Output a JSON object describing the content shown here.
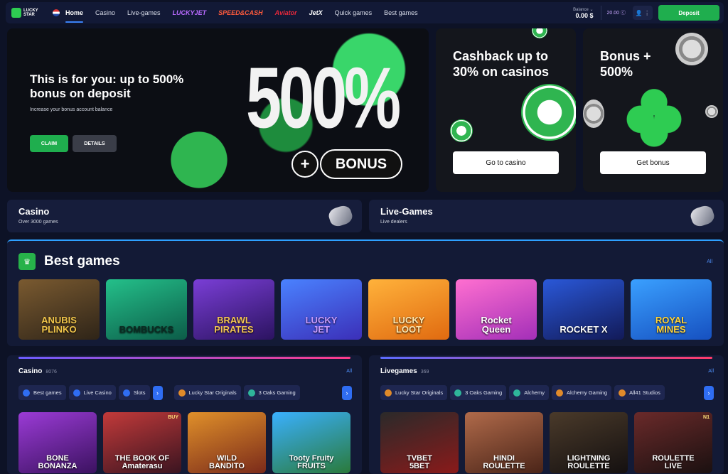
{
  "header": {
    "logo_text": "LUCKY STAR",
    "nav": [
      {
        "label": "Home",
        "active": true
      },
      {
        "label": "Casino"
      },
      {
        "label": "Live-games"
      },
      {
        "label": "LUCKYJET",
        "brand": true,
        "color": "#b96bff"
      },
      {
        "label": "SPEED&CASH",
        "brand": true,
        "color": "#ff5a3c"
      },
      {
        "label": "Aviator",
        "brand": true,
        "color": "#e8283b"
      },
      {
        "label": "JetX",
        "brand": true,
        "color": "#ffffff"
      },
      {
        "label": "Quick games"
      },
      {
        "label": "Best games"
      }
    ],
    "balance_label": "Balance ⌄",
    "balance_value": "0.00 $",
    "coins": "20.00 ⓒ",
    "user_icon": "👤 ⋮",
    "deposit_label": "Deposit"
  },
  "hero": {
    "title": "This is for you: up to 500% bonus on deposit",
    "subtitle": "Increase your bonus account balance",
    "claim_label": "CLAIM",
    "details_label": "DETAILS",
    "big_text": "500%",
    "plus": "+",
    "bonus_word": "BONUS"
  },
  "promos": {
    "cashback_title": "Cashback up to 30% on casinos",
    "cashback_button": "Go to casino",
    "bonus_title": "Bonus + 500%",
    "bonus_button": "Get bonus"
  },
  "categories": {
    "casino_title": "Casino",
    "casino_sub": "Over 3000 games",
    "live_title": "Live-Games",
    "live_sub": "Live dealers"
  },
  "best_games": {
    "icon": "♛",
    "title": "Best games",
    "all_label": "All",
    "tiles": [
      {
        "name": "ANUBIS\nPLINKO",
        "bg": "linear-gradient(160deg,#7a5a30,#2e2418)",
        "color": "#f1c54a"
      },
      {
        "name": "BOMBUCKS",
        "bg": "linear-gradient(160deg,#24c08a,#0c5c48)",
        "color": "#0b2b22"
      },
      {
        "name": "BRAWL\nPIRATES",
        "bg": "linear-gradient(160deg,#7a3ed6,#2b1360)",
        "color": "#f3c453"
      },
      {
        "name": "LUCKY\nJET",
        "bg": "linear-gradient(160deg,#4a82ff,#3b2fb8)",
        "color": "#c89bff"
      },
      {
        "name": "LUCKY\nLOOT",
        "bg": "linear-gradient(160deg,#ffb23b,#e06a10)",
        "color": "#ffe8b0"
      },
      {
        "name": "Rocket\nQueen",
        "bg": "linear-gradient(160deg,#ff6fd0,#a32fb8)",
        "color": "#ffffff"
      },
      {
        "name": "ROCKET X",
        "bg": "linear-gradient(160deg,#2a58d8,#121a58)",
        "color": "#ffffff"
      },
      {
        "name": "ROYAL\nMINES",
        "bg": "linear-gradient(160deg,#3aa0ff,#1650c0)",
        "color": "#ffd43a"
      }
    ]
  },
  "casino_section": {
    "title": "Casino",
    "count": "8076",
    "all_label": "All",
    "chips": [
      {
        "label": "Best games",
        "icon_color": "#2f6df2"
      },
      {
        "label": "Live Casino",
        "icon_color": "#2f6df2"
      },
      {
        "label": "Slots",
        "icon_color": "#2f6df2"
      }
    ],
    "provider_chips": [
      {
        "label": "Lucky Star Originals",
        "icon_color": "#e08a2a"
      },
      {
        "label": "3 Oaks Gaming",
        "icon_color": "#2fb59a"
      }
    ],
    "games": [
      {
        "name": "BONE\nBONANZA",
        "bg": "linear-gradient(160deg,#9b3bd6,#3b1260)",
        "tag": ""
      },
      {
        "name": "THE BOOK OF\nAmaterasu",
        "bg": "linear-gradient(160deg,#c23a3a,#3a1420)",
        "tag": "BUY"
      },
      {
        "name": "WILD\nBANDITO",
        "bg": "linear-gradient(160deg,#e0902a,#7a2a1a)",
        "tag": ""
      },
      {
        "name": "Tooty Fruity\nFRUITS",
        "bg": "linear-gradient(160deg,#3ab0ff,#2a7a3a)",
        "tag": ""
      }
    ]
  },
  "live_section": {
    "title": "Livegames",
    "count": "369",
    "all_label": "All",
    "chips": [
      {
        "label": "Lucky Star Originals",
        "icon_color": "#e08a2a"
      },
      {
        "label": "3 Oaks Gaming",
        "icon_color": "#2fb59a"
      },
      {
        "label": "Alchemy",
        "icon_color": "#2fb59a"
      },
      {
        "label": "Alchemy Gaming",
        "icon_color": "#e08a2a"
      },
      {
        "label": "All41 Studios",
        "icon_color": "#e08a2a"
      }
    ],
    "games": [
      {
        "name": "TVBET\n5BET",
        "bg": "linear-gradient(160deg,#2a2a2a,#8a1a1a)",
        "tag": ""
      },
      {
        "name": "HINDI\nROULETTE",
        "bg": "linear-gradient(160deg,#b06a4a,#4a2418)",
        "tag": ""
      },
      {
        "name": "LIGHTNING\nROULETTE",
        "bg": "linear-gradient(160deg,#4a3a2a,#141010)",
        "tag": ""
      },
      {
        "name": "ROULETTE\nLIVE",
        "bg": "linear-gradient(160deg,#6a2a2a,#1a1010)",
        "tag": "N1"
      }
    ]
  }
}
